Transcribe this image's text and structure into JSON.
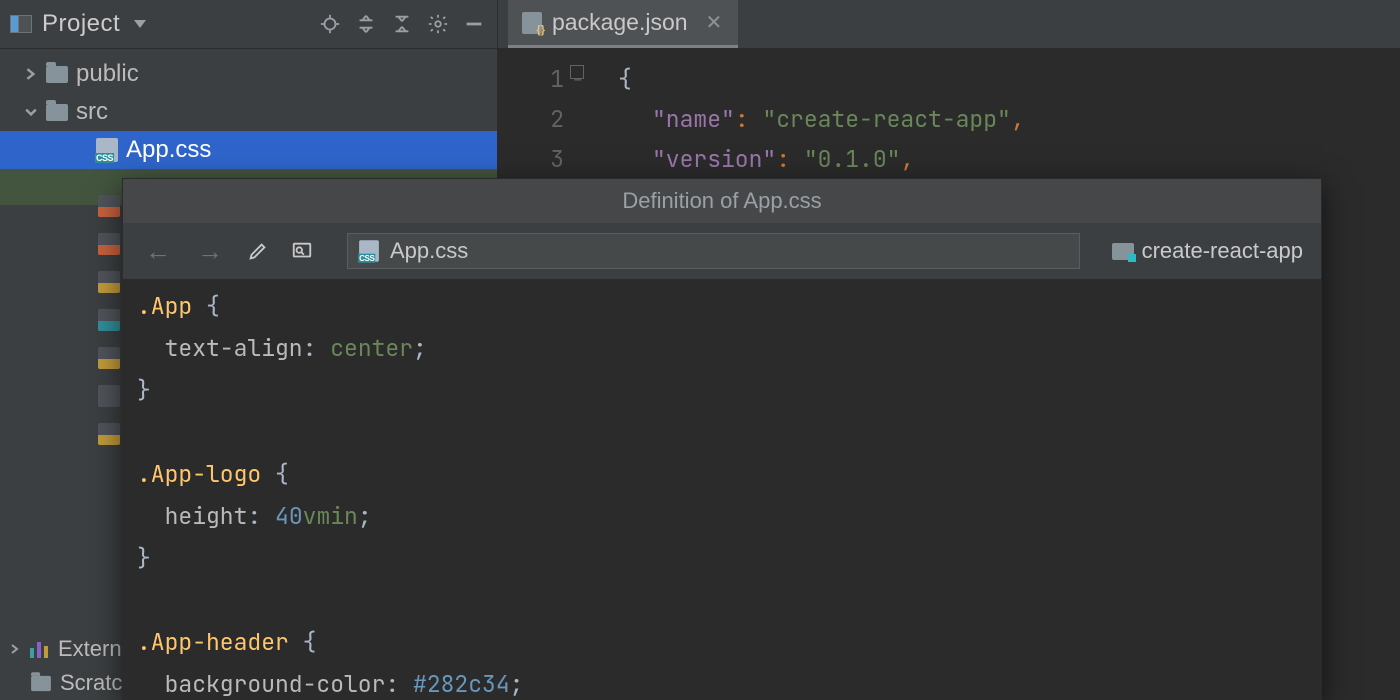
{
  "sidebar": {
    "title": "Project",
    "nodes": {
      "public": "public",
      "src": "src",
      "appcss": "App.css"
    },
    "bottom": {
      "external": "External Libraries",
      "scratches": "Scratches and Consoles"
    }
  },
  "tab": {
    "label": "package.json"
  },
  "code": {
    "ln1": "1",
    "ln2": "2",
    "ln3": "3",
    "brace": "{",
    "k_name": "\"name\"",
    "v_name": "\"create-react-app\"",
    "k_ver": "\"version\"",
    "v_ver": "\"0.1.0\""
  },
  "popup": {
    "title": "Definition of App.css",
    "breadcrumb": "App.css",
    "project": "create-react-app",
    "css": {
      "sel1": ".App",
      "p1": "text-align",
      "v1": "center",
      "sel2": ".App-logo",
      "p2": "height",
      "v2n": "40",
      "v2u": "vmin",
      "sel3": ".App-header",
      "p3": "background-color",
      "v3": "#282c34"
    }
  }
}
